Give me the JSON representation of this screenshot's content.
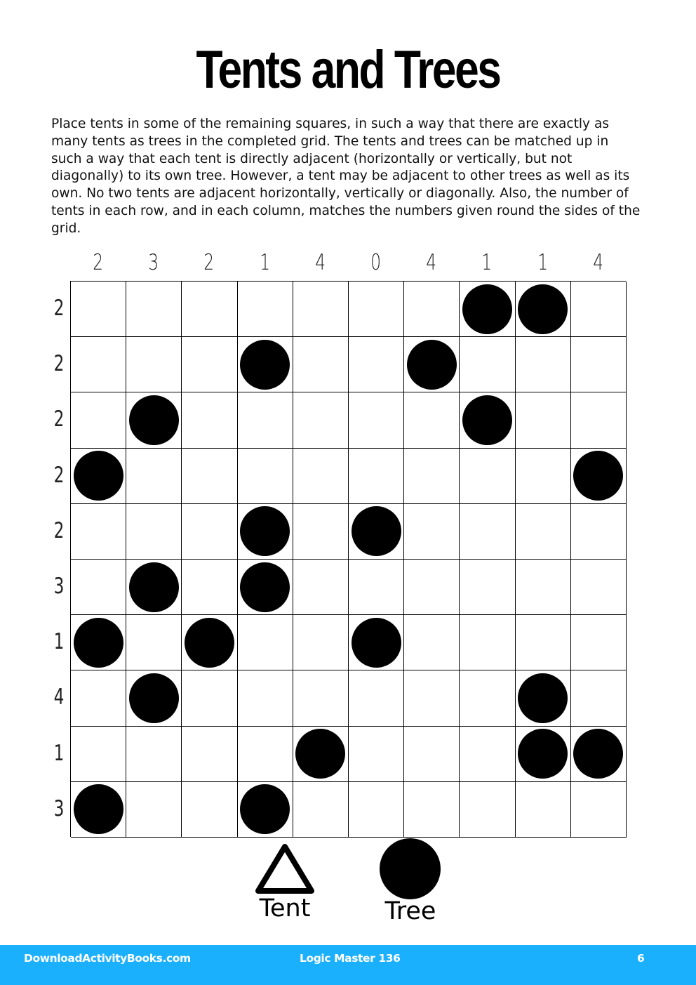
{
  "page": {
    "title": "Tents and Trees",
    "instructions": "Place tents in some of the remaining squares, in such a way that there are exactly as many tents as trees in the completed grid. The tents and trees can be matched up in such a way that each tent is directly adjacent (horizontally or vertically, but not diagonally) to its own tree. However, a tent may be adjacent to other trees as well as its own. No two tents are adjacent horizontally, vertically or diagonally. Also, the number of tents in each row, and in each column, matches the numbers given round the sides of the grid."
  },
  "puzzle": {
    "rows": 10,
    "cols": 10,
    "column_clues": [
      "2",
      "3",
      "2",
      "1",
      "4",
      "0",
      "4",
      "1",
      "1",
      "4"
    ],
    "row_clues": [
      "2",
      "2",
      "2",
      "2",
      "2",
      "3",
      "1",
      "4",
      "1",
      "3"
    ],
    "cells": [
      [
        0,
        0,
        0,
        0,
        0,
        0,
        0,
        1,
        1,
        0
      ],
      [
        0,
        0,
        0,
        1,
        0,
        0,
        1,
        0,
        0,
        0
      ],
      [
        0,
        1,
        0,
        0,
        0,
        0,
        0,
        1,
        0,
        0
      ],
      [
        1,
        0,
        0,
        0,
        0,
        0,
        0,
        0,
        0,
        1
      ],
      [
        0,
        0,
        0,
        1,
        0,
        1,
        0,
        0,
        0,
        0
      ],
      [
        0,
        1,
        0,
        1,
        0,
        0,
        0,
        0,
        0,
        0
      ],
      [
        1,
        0,
        1,
        0,
        0,
        1,
        0,
        0,
        0,
        0
      ],
      [
        0,
        1,
        0,
        0,
        0,
        0,
        0,
        0,
        1,
        0
      ],
      [
        0,
        0,
        0,
        0,
        1,
        0,
        0,
        0,
        1,
        1
      ],
      [
        1,
        0,
        0,
        1,
        0,
        0,
        0,
        0,
        0,
        0
      ]
    ],
    "cell_legend": {
      "0": "empty",
      "1": "tree"
    }
  },
  "legend": {
    "tent_label": "Tent",
    "tent_icon": "triangle-outline",
    "tree_label": "Tree",
    "tree_icon": "filled-circle"
  },
  "footer": {
    "site": "DownloadActivityBooks.com",
    "book": "Logic Master 136",
    "page_number": "6",
    "background_color": "#1bb0fd"
  }
}
